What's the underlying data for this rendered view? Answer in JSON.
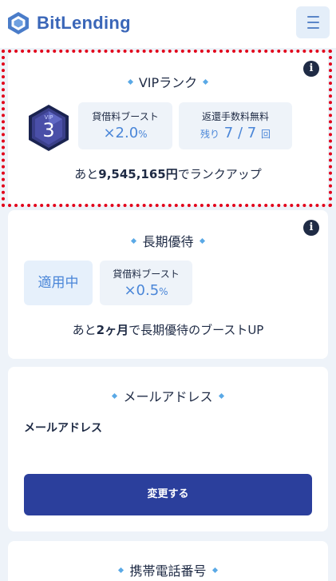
{
  "header": {
    "brand": "BitLending",
    "brand_color": "#3a66b8",
    "menu_icon": "hamburger-icon"
  },
  "vip": {
    "title": "VIPランク",
    "badge_text": "VIP",
    "badge_rank": "3",
    "boost_label": "貸借料ブースト",
    "boost_value": "×2.0",
    "boost_unit": "%",
    "fee_label": "返還手数料無料",
    "fee_prefix": "残り",
    "fee_used": "7",
    "fee_sep": "/",
    "fee_total": "7",
    "fee_suffix": "回",
    "rankup_prefix": "あと",
    "rankup_amount": "9,545,165円",
    "rankup_suffix": "でランクアップ"
  },
  "long_term": {
    "title": "長期優待",
    "status": "適用中",
    "boost_label": "貸借料ブースト",
    "boost_value": "×0.5",
    "boost_unit": "%",
    "note_prefix": "あと",
    "note_period": "2ヶ月",
    "note_suffix": "で長期優待のブーストUP"
  },
  "email": {
    "title": "メールアドレス",
    "label": "メールアドレス",
    "button": "変更する"
  },
  "phone": {
    "title": "携帯電話番号"
  },
  "colors": {
    "accent": "#4a86d8",
    "button": "#2b3f9c",
    "highlight_border": "#e2001a"
  }
}
